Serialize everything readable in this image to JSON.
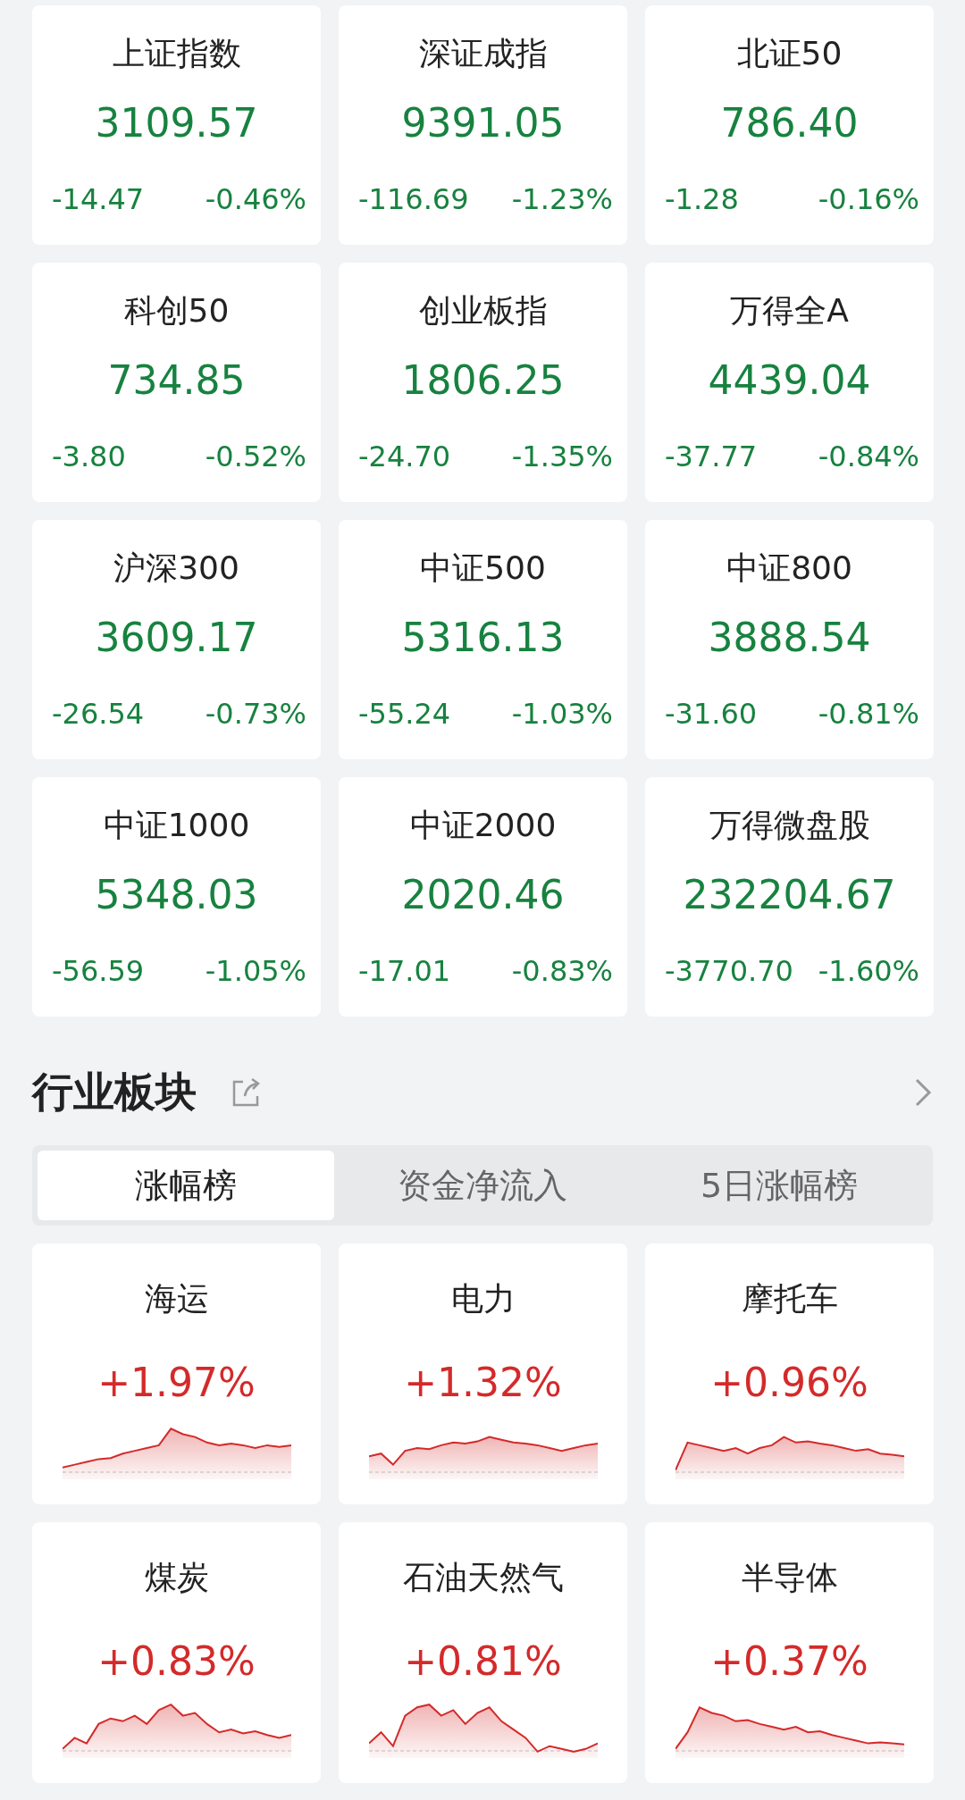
{
  "indices": [
    {
      "name": "上证指数",
      "value": "3109.57",
      "change": "-14.47",
      "percent": "-0.46%",
      "color": "#17823f"
    },
    {
      "name": "深证成指",
      "value": "9391.05",
      "change": "-116.69",
      "percent": "-1.23%",
      "color": "#17823f"
    },
    {
      "name": "北证50",
      "value": "786.40",
      "change": "-1.28",
      "percent": "-0.16%",
      "color": "#17823f"
    },
    {
      "name": "科创50",
      "value": "734.85",
      "change": "-3.80",
      "percent": "-0.52%",
      "color": "#17823f"
    },
    {
      "name": "创业板指",
      "value": "1806.25",
      "change": "-24.70",
      "percent": "-1.35%",
      "color": "#17823f"
    },
    {
      "name": "万得全A",
      "value": "4439.04",
      "change": "-37.77",
      "percent": "-0.84%",
      "color": "#17823f"
    },
    {
      "name": "沪深300",
      "value": "3609.17",
      "change": "-26.54",
      "percent": "-0.73%",
      "color": "#17823f"
    },
    {
      "name": "中证500",
      "value": "5316.13",
      "change": "-55.24",
      "percent": "-1.03%",
      "color": "#17823f"
    },
    {
      "name": "中证800",
      "value": "3888.54",
      "change": "-31.60",
      "percent": "-0.81%",
      "color": "#17823f"
    },
    {
      "name": "中证1000",
      "value": "5348.03",
      "change": "-56.59",
      "percent": "-1.05%",
      "color": "#17823f"
    },
    {
      "name": "中证2000",
      "value": "2020.46",
      "change": "-17.01",
      "percent": "-0.83%",
      "color": "#17823f"
    },
    {
      "name": "万得微盘股",
      "value": "232204.67",
      "change": "-3770.70",
      "percent": "-1.60%",
      "color": "#17823f"
    }
  ],
  "sectors": {
    "title": "行业板块",
    "tabs": [
      {
        "label": "涨幅榜",
        "selected": true
      },
      {
        "label": "资金净流入",
        "selected": false
      },
      {
        "label": "5日涨幅榜",
        "selected": false
      }
    ],
    "items": [
      {
        "name": "海运",
        "percent": "+1.97%",
        "color": "#d42a2a"
      },
      {
        "name": "电力",
        "percent": "+1.32%",
        "color": "#d42a2a"
      },
      {
        "name": "摩托车",
        "percent": "+0.96%",
        "color": "#d42a2a"
      },
      {
        "name": "煤炭",
        "percent": "+0.83%",
        "color": "#d42a2a"
      },
      {
        "name": "石油天然气",
        "percent": "+0.81%",
        "color": "#d42a2a"
      },
      {
        "name": "半导体",
        "percent": "+0.37%",
        "color": "#d42a2a"
      }
    ]
  }
}
